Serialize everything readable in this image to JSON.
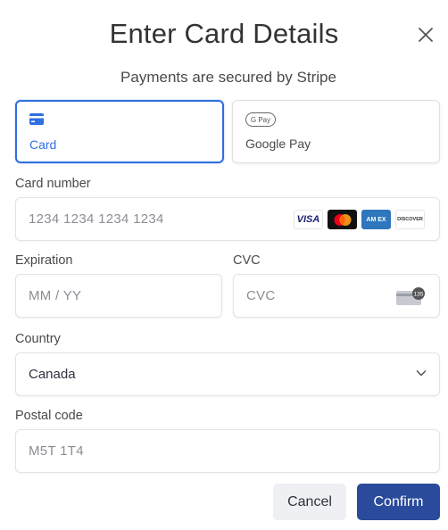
{
  "dialog": {
    "title": "Enter Card Details",
    "subtitle": "Payments are secured by Stripe",
    "close_icon": "close-icon"
  },
  "tabs": [
    {
      "label": "Card",
      "icon": "credit-card-icon",
      "selected": true
    },
    {
      "label": "Google Pay",
      "icon": "google-pay-icon",
      "icon_text": "G Pay",
      "selected": false
    }
  ],
  "form": {
    "card_number": {
      "label": "Card number",
      "placeholder": "1234 1234 1234 1234",
      "value": ""
    },
    "card_brands": {
      "visa": "VISA",
      "mastercard": "mastercard-logo",
      "amex": "AM EX",
      "discover": "DISCOVER"
    },
    "expiration": {
      "label": "Expiration",
      "placeholder": "MM / YY",
      "value": ""
    },
    "cvc": {
      "label": "CVC",
      "placeholder": "CVC",
      "value": "",
      "icon_text": "135"
    },
    "country": {
      "label": "Country",
      "value": "Canada"
    },
    "postal_code": {
      "label": "Postal code",
      "value": "M5T 1T4"
    }
  },
  "actions": {
    "cancel": "Cancel",
    "confirm": "Confirm"
  },
  "colors": {
    "accent": "#2f6fe0",
    "confirm_bg": "#2a4b9b",
    "cancel_bg": "#eef0f4"
  }
}
